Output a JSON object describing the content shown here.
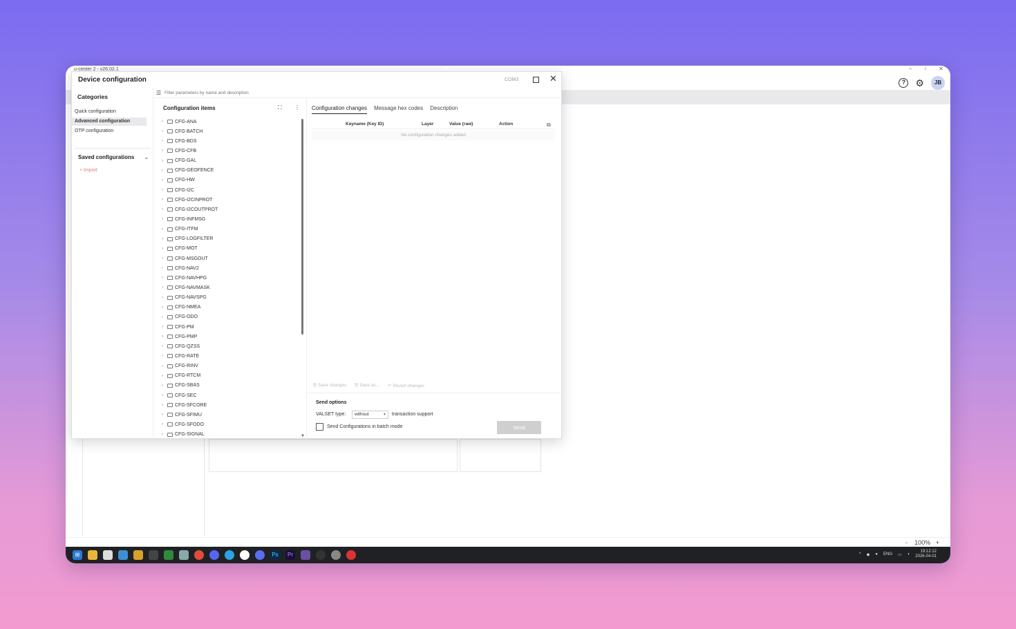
{
  "app": {
    "title": "u-center 2 - v26.02.1",
    "window_controls": [
      "–",
      "▫",
      "✕"
    ],
    "header_icons": [
      "help-icon",
      "gear-icon"
    ],
    "avatar": "JB",
    "zoom": "100%",
    "zoom_plus": "+",
    "zoom_minus": "-"
  },
  "dialog": {
    "title": "Device configuration",
    "port": "COM3",
    "close": "✕"
  },
  "categories": {
    "title": "Categories",
    "items": [
      {
        "label": "Quick configuration",
        "active": false
      },
      {
        "label": "Advanced configuration",
        "active": true
      },
      {
        "label": "OTP configuration",
        "active": false
      }
    ],
    "saved_title": "Saved configurations",
    "import_label": "+ Import"
  },
  "filter": {
    "placeholder": "Filter parameters by name and description"
  },
  "tree": {
    "title": "Configuration items",
    "items": [
      "CFG-ANA",
      "CFG-BATCH",
      "CFG-BDS",
      "CFG-CFB",
      "CFG-GAL",
      "CFG-GEOFENCE",
      "CFG-HW",
      "CFG-I2C",
      "CFG-I2CINPROT",
      "CFG-I2COUTPROT",
      "CFG-INFMSG",
      "CFG-ITFM",
      "CFG-LOGFILTER",
      "CFG-MOT",
      "CFG-MSGOUT",
      "CFG-NAV2",
      "CFG-NAVHPG",
      "CFG-NAVMASK",
      "CFG-NAVSPG",
      "CFG-NMEA",
      "CFG-ODO",
      "CFG-PM",
      "CFG-PMP",
      "CFG-QZSS",
      "CFG-RATE",
      "CFG-RINV",
      "CFG-RTCM",
      "CFG-SBAS",
      "CFG-SEC",
      "CFG-SFCORE",
      "CFG-SFIMU",
      "CFG-SFODO",
      "CFG-SIGNAL"
    ]
  },
  "tabs": [
    {
      "label": "Configuration changes",
      "active": true
    },
    {
      "label": "Message hex codes",
      "active": false
    },
    {
      "label": "Description",
      "active": false
    }
  ],
  "grid": {
    "columns": [
      "Keyname (Key ID)",
      "Layer",
      "Value (raw)",
      "Action"
    ],
    "empty_text": "No configuration changes added"
  },
  "actions": {
    "save_changes": "Save changes",
    "save_as": "Save as...",
    "revert_changes": "Revert changes"
  },
  "send_options": {
    "title": "Send options",
    "valset_label": "VALSET type:",
    "valset_value": "without",
    "transaction_label": "transaction support",
    "batch_label": "Send Configurations in batch mode",
    "send_label": "Send"
  },
  "taskbar": {
    "lang": "ENG",
    "time": "19:12:12",
    "date": "2026-04-01"
  }
}
